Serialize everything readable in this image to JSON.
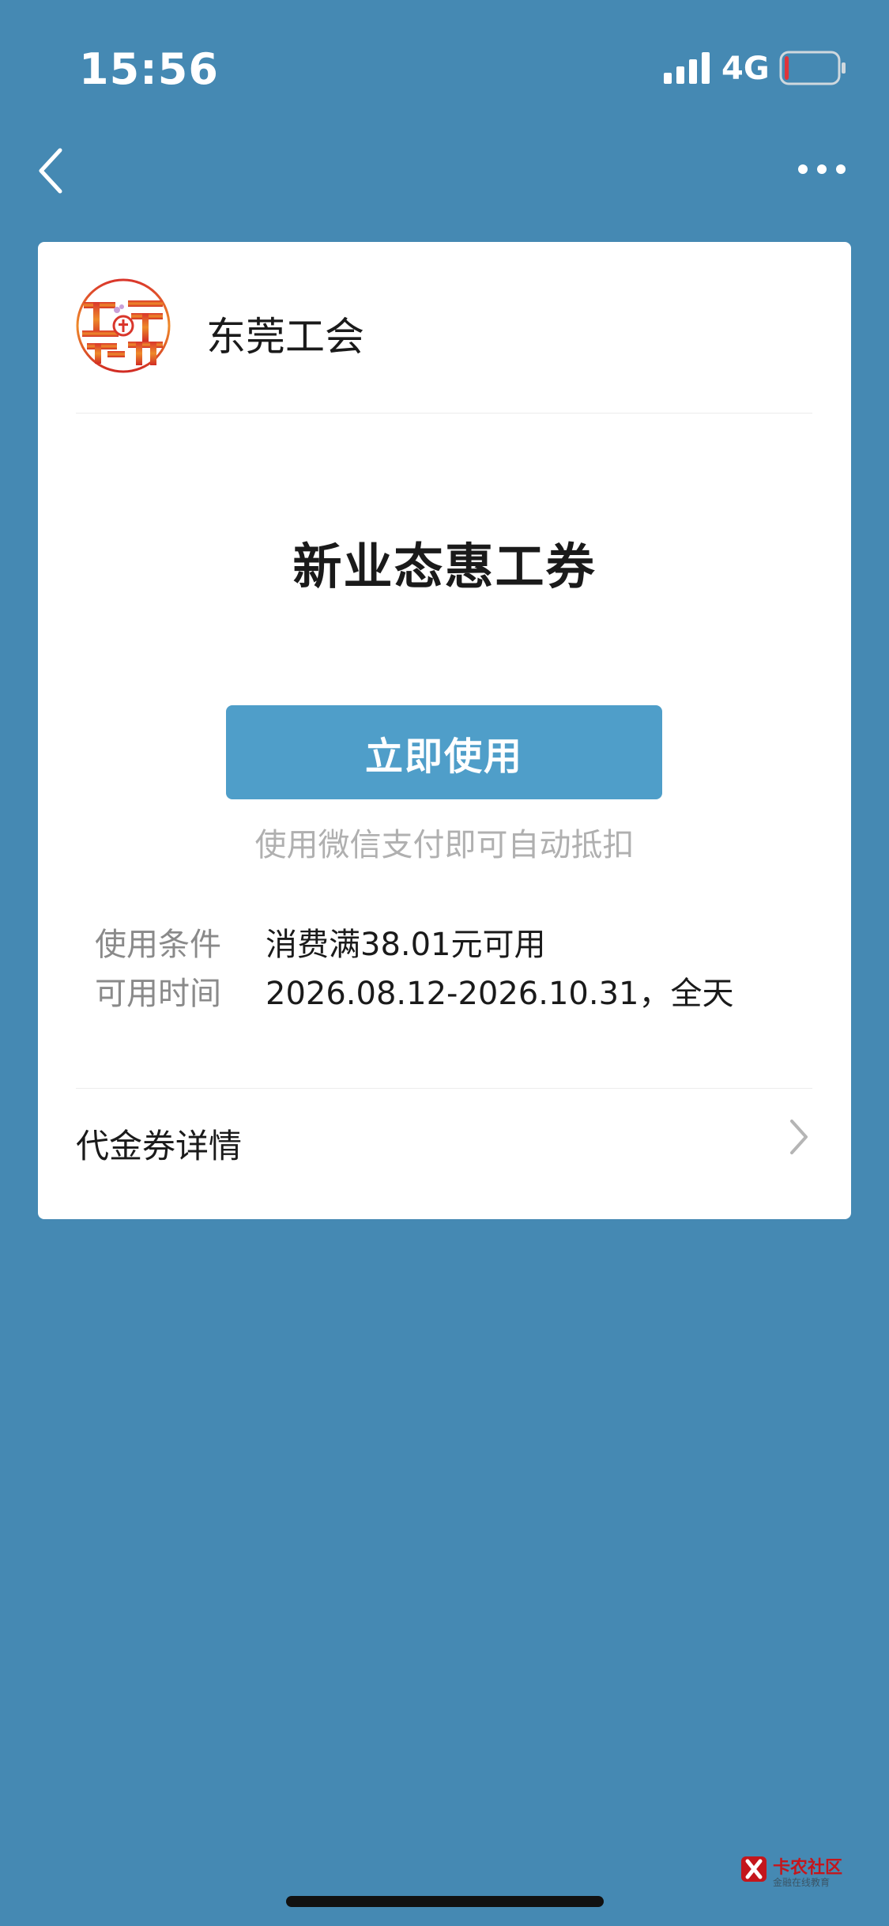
{
  "status_bar": {
    "time": "15:56",
    "network": "4G",
    "signal_icon": "cellular-signal-icon",
    "battery_icon": "battery-low-icon",
    "battery_level": 0.08
  },
  "nav": {
    "back_icon": "chevron-left-icon",
    "more_icon": "more-dots-icon"
  },
  "merchant": {
    "name": "东莞工会",
    "logo_icon": "union-seal-logo"
  },
  "coupon": {
    "title": "新业态惠工券",
    "use_button": "立即使用",
    "hint": "使用微信支付即可自动抵扣",
    "conditions": [
      {
        "label": "使用条件",
        "value": "消费满38.01元可用"
      },
      {
        "label": "可用时间",
        "value": "2026.08.12-2026.10.31，全天"
      }
    ],
    "details_label": "代金券详情",
    "details_icon": "chevron-right-icon"
  },
  "watermark": {
    "text": "卡农社区",
    "sub": "金融在线教育"
  },
  "colors": {
    "background": "#4589b3",
    "card": "#ffffff",
    "button": "#4f9ec9",
    "watermark": "#c4161c"
  }
}
